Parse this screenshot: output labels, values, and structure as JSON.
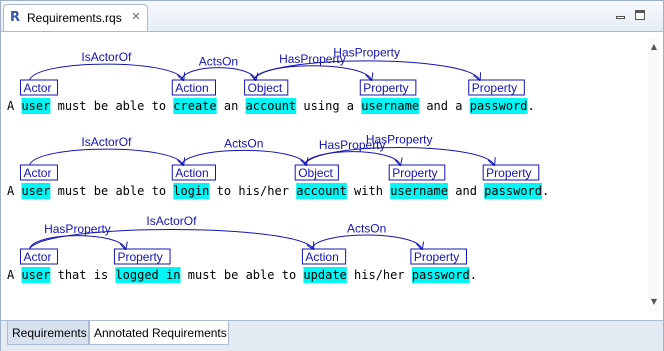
{
  "editor_tab": {
    "title": "Requirements.rqs",
    "icon": "r-file-icon",
    "close_symbol": "✕"
  },
  "window_controls": [
    "minimize-icon",
    "maximize-icon"
  ],
  "bottom_tabs": [
    {
      "label": "Requirements",
      "active": false
    },
    {
      "label": "Annotated Requirements",
      "active": true
    }
  ],
  "colors": {
    "highlight": "#00f5f5",
    "annotation": "#1414b4",
    "text": "#000000"
  },
  "requirements": [
    {
      "tokens": [
        {
          "text": "A",
          "hl": false
        },
        {
          "text": "user",
          "hl": true,
          "tag": "Actor"
        },
        {
          "text": "must",
          "hl": false
        },
        {
          "text": "be",
          "hl": false
        },
        {
          "text": "able",
          "hl": false
        },
        {
          "text": "to",
          "hl": false
        },
        {
          "text": "create",
          "hl": true,
          "tag": "Action"
        },
        {
          "text": "an",
          "hl": false
        },
        {
          "text": "account",
          "hl": true,
          "tag": "Object"
        },
        {
          "text": "using",
          "hl": false
        },
        {
          "text": "a",
          "hl": false
        },
        {
          "text": "username",
          "hl": true,
          "tag": "Property"
        },
        {
          "text": "and",
          "hl": false
        },
        {
          "text": "a",
          "hl": false
        },
        {
          "text": "password",
          "hl": true,
          "tag": "Property"
        },
        {
          "text": ".",
          "hl": false
        }
      ],
      "relations": [
        {
          "label": "IsActorOf",
          "from": 1,
          "to": 6
        },
        {
          "label": "ActsOn",
          "from": 6,
          "to": 8
        },
        {
          "label": "HasProperty",
          "from": 8,
          "to": 11
        },
        {
          "label": "HasProperty",
          "from": 8,
          "to": 14
        }
      ]
    },
    {
      "tokens": [
        {
          "text": "A",
          "hl": false
        },
        {
          "text": "user",
          "hl": true,
          "tag": "Actor"
        },
        {
          "text": "must",
          "hl": false
        },
        {
          "text": "be",
          "hl": false
        },
        {
          "text": "able",
          "hl": false
        },
        {
          "text": "to",
          "hl": false
        },
        {
          "text": "login",
          "hl": true,
          "tag": "Action"
        },
        {
          "text": "to",
          "hl": false
        },
        {
          "text": "his/her",
          "hl": false
        },
        {
          "text": "account",
          "hl": true,
          "tag": "Object"
        },
        {
          "text": "with",
          "hl": false
        },
        {
          "text": "username",
          "hl": true,
          "tag": "Property"
        },
        {
          "text": "and",
          "hl": false
        },
        {
          "text": "password",
          "hl": true,
          "tag": "Property"
        },
        {
          "text": ".",
          "hl": false
        }
      ],
      "relations": [
        {
          "label": "IsActorOf",
          "from": 1,
          "to": 6
        },
        {
          "label": "ActsOn",
          "from": 6,
          "to": 9
        },
        {
          "label": "HasProperty",
          "from": 9,
          "to": 11
        },
        {
          "label": "HasProperty",
          "from": 9,
          "to": 13
        }
      ]
    },
    {
      "tokens": [
        {
          "text": "A",
          "hl": false
        },
        {
          "text": "user",
          "hl": true,
          "tag": "Actor"
        },
        {
          "text": "that",
          "hl": false
        },
        {
          "text": "is",
          "hl": false
        },
        {
          "text": "logged in",
          "hl": true,
          "tag": "Property"
        },
        {
          "text": "must",
          "hl": false
        },
        {
          "text": "be",
          "hl": false
        },
        {
          "text": "able",
          "hl": false
        },
        {
          "text": "to",
          "hl": false
        },
        {
          "text": "update",
          "hl": true,
          "tag": "Action"
        },
        {
          "text": "his/her",
          "hl": false
        },
        {
          "text": "password",
          "hl": true,
          "tag": "Property"
        },
        {
          "text": ".",
          "hl": false
        }
      ],
      "relations": [
        {
          "label": "HasProperty",
          "from": 1,
          "to": 4
        },
        {
          "label": "IsActorOf",
          "from": 1,
          "to": 9
        },
        {
          "label": "ActsOn",
          "from": 9,
          "to": 11
        }
      ]
    }
  ]
}
